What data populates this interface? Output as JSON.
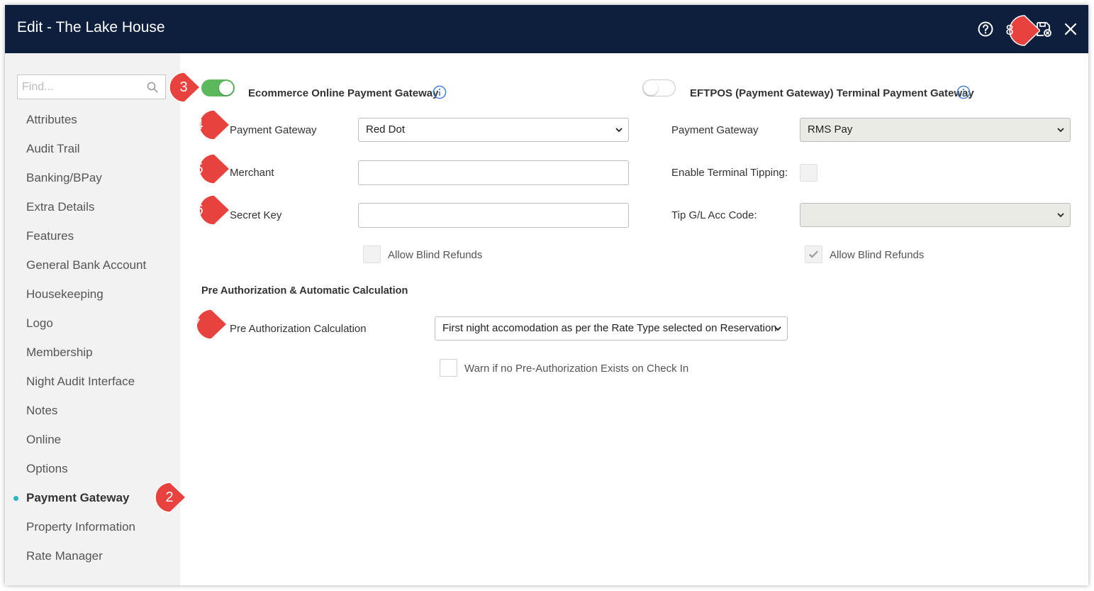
{
  "window": {
    "title": "Edit - The Lake House"
  },
  "sidebar": {
    "find_placeholder": "Find...",
    "items": [
      {
        "label": "Attributes",
        "active": false
      },
      {
        "label": "Audit Trail",
        "active": false
      },
      {
        "label": "Banking/BPay",
        "active": false
      },
      {
        "label": "Extra Details",
        "active": false
      },
      {
        "label": "Features",
        "active": false
      },
      {
        "label": "General Bank Account",
        "active": false
      },
      {
        "label": "Housekeeping",
        "active": false
      },
      {
        "label": "Logo",
        "active": false
      },
      {
        "label": "Membership",
        "active": false
      },
      {
        "label": "Night Audit Interface",
        "active": false
      },
      {
        "label": "Notes",
        "active": false
      },
      {
        "label": "Online",
        "active": false
      },
      {
        "label": "Options",
        "active": false
      },
      {
        "label": "Payment Gateway",
        "active": true
      },
      {
        "label": "Property Information",
        "active": false
      },
      {
        "label": "Rate Manager",
        "active": false
      }
    ]
  },
  "ecommerce": {
    "toggle_label": "Ecommerce Online Payment Gateway",
    "enabled": true,
    "payment_gateway_label": "Payment Gateway",
    "payment_gateway_value": "Red Dot",
    "merchant_label": "Merchant",
    "merchant_value": "",
    "secret_key_label": "Secret Key",
    "secret_key_value": "",
    "allow_blind_refunds_label": "Allow Blind Refunds",
    "allow_blind_refunds_checked": false
  },
  "eftpos": {
    "toggle_label": "EFTPOS (Payment Gateway) Terminal Payment Gateway",
    "enabled": false,
    "payment_gateway_label": "Payment Gateway",
    "payment_gateway_value": "RMS Pay",
    "terminal_tipping_label": "Enable Terminal Tipping:",
    "tip_gl_label": "Tip G/L Acc Code:",
    "tip_gl_value": "",
    "allow_blind_refunds_label": "Allow Blind Refunds",
    "allow_blind_refunds_checked": true
  },
  "preauth": {
    "section_title": "Pre Authorization & Automatic Calculation",
    "calc_label": "Pre Authorization Calculation",
    "calc_value": "First night accomodation as per the Rate Type selected on Reservation",
    "warn_label": "Warn if no Pre-Authorization Exists on Check In",
    "warn_checked": false
  },
  "markers": [
    "2",
    "3",
    "4",
    "5",
    "6",
    "7",
    "8"
  ],
  "colors": {
    "titlebar": "#0d1f3c",
    "toggle_on": "#5cb85c",
    "active_dot": "#2cb5c9",
    "marker": "#e8423f",
    "info": "#3b7dd8"
  },
  "icons": {
    "help": "help-circle-icon",
    "save_close": "save-close-icon",
    "close": "close-icon",
    "search": "search-icon",
    "info": "info-icon"
  }
}
